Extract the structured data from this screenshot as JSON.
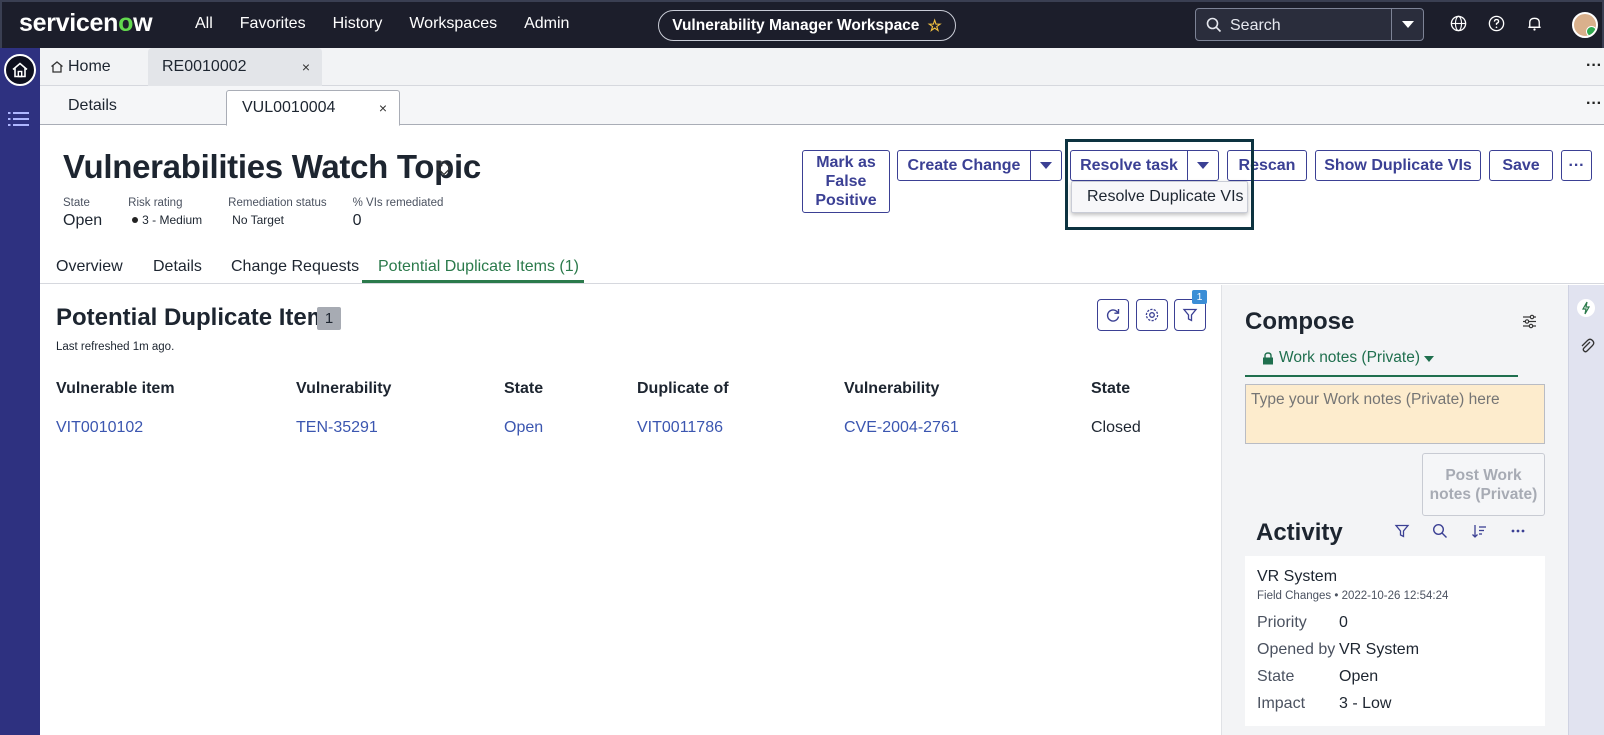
{
  "topnav": {
    "logo_prefix": "servicen",
    "logo_o": "o",
    "logo_suffix": "w",
    "items": [
      "All",
      "Favorites",
      "History",
      "Workspaces",
      "Admin"
    ],
    "workspace": "Vulnerability Manager Workspace",
    "search_placeholder": "Search"
  },
  "tabs_level1": {
    "home_label": "Home",
    "active_label": "RE0010002",
    "close": "×",
    "more": "···"
  },
  "tabs_level2": {
    "details_label": "Details",
    "active_label": "VUL0010004",
    "close": "×",
    "more": "···"
  },
  "record": {
    "title": "Vulnerabilities Watch Topic",
    "fields": [
      {
        "label": "State",
        "value": "Open"
      },
      {
        "label": "Risk rating",
        "value": "3 - Medium"
      },
      {
        "label": "Remediation status",
        "value": "No Target"
      },
      {
        "label": "% VIs remediated",
        "value": "0"
      }
    ],
    "buttons": {
      "mark_false_positive": "Mark as False Positive",
      "create_change": "Create Change",
      "resolve_task": "Resolve task",
      "rescan": "Rescan",
      "show_duplicates": "Show Duplicate VIs",
      "save": "Save",
      "more": "···"
    },
    "dropdown_item": "Resolve Duplicate VIs"
  },
  "record_tabs": [
    "Overview",
    "Details",
    "Change Requests",
    "Potential Duplicate Items (1)"
  ],
  "list": {
    "title": "Potential Duplicate Items",
    "count": "1",
    "refreshed": "Last refreshed 1m ago.",
    "filter_badge": "1",
    "columns": [
      "Vulnerable item",
      "Vulnerability",
      "State",
      "Duplicate of",
      "Vulnerability",
      "State"
    ],
    "rows": [
      [
        "VIT0010102",
        "TEN-35291",
        "Open",
        "VIT0011786",
        "CVE-2004-2761",
        "Closed"
      ]
    ]
  },
  "compose": {
    "title": "Compose",
    "work_notes_label": "Work notes (Private)",
    "placeholder": "Type your Work notes (Private) here",
    "post_button": "Post Work notes (Private)"
  },
  "activity": {
    "title": "Activity",
    "entry": {
      "author": "VR System",
      "type": "Field Changes",
      "timestamp": "2022-10-26 12:54:24",
      "changes": [
        {
          "field": "Priority",
          "value": "0"
        },
        {
          "field": "Opened by",
          "value": "VR System"
        },
        {
          "field": "State",
          "value": "Open"
        },
        {
          "field": "Impact",
          "value": "3 - Low"
        }
      ]
    }
  },
  "colors": {
    "nav_bg": "#1c1e2b",
    "primary": "#3b4094",
    "link": "#3b56b0",
    "active_tab": "#2b7a4b",
    "work_notes_bg": "#fdeccd"
  }
}
